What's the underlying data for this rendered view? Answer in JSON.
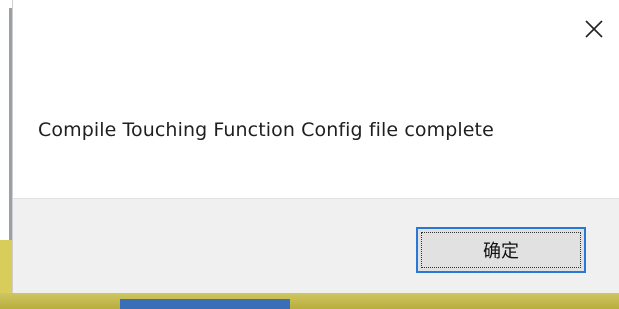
{
  "dialog": {
    "close_icon": "close-icon",
    "message": "Compile Touching Function Config file complete",
    "ok_label": "确定"
  },
  "colors": {
    "dialog_background": "#ffffff",
    "footer_background": "#f0f0f0",
    "button_border": "#2b78d4",
    "button_background": "#e1e1e1"
  }
}
